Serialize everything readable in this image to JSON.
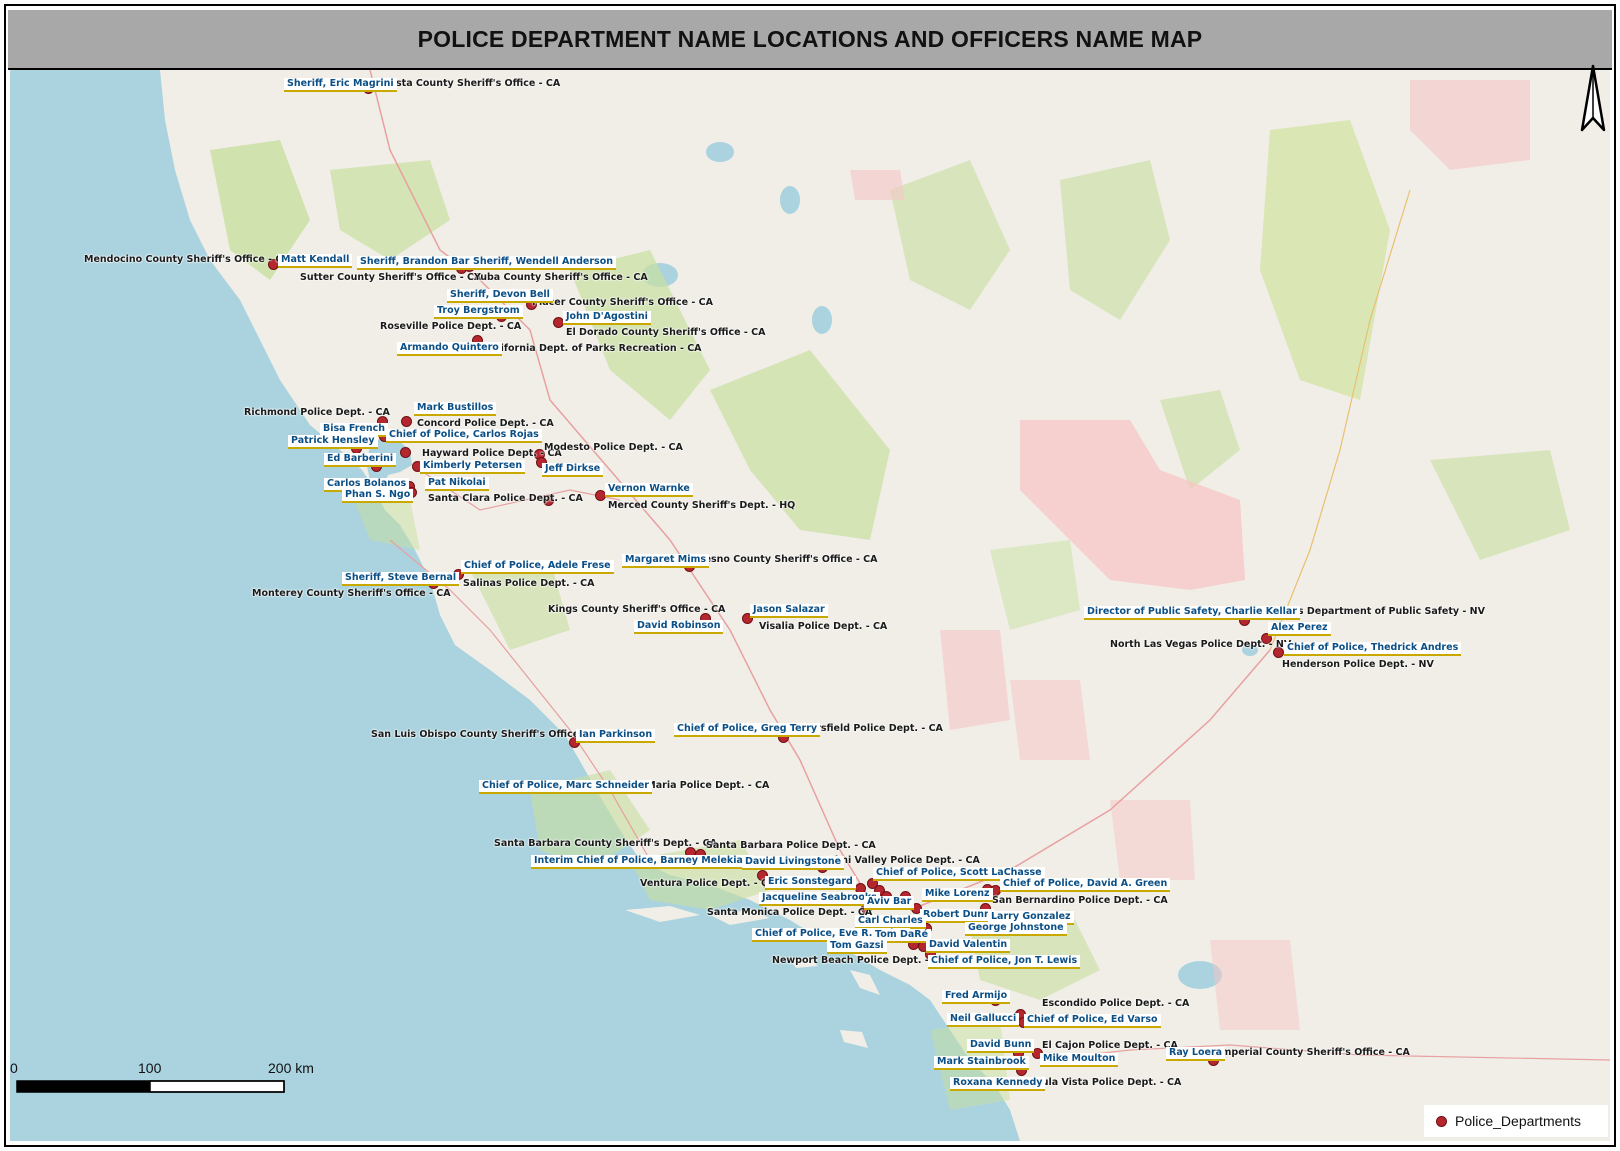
{
  "title": "POLICE DEPARTMENT NAME LOCATIONS AND OFFICERS NAME MAP",
  "colors": {
    "water": "#aad3df",
    "land": "#f1eee8",
    "park": "#c8df9f",
    "restricted": "#f5c6c6",
    "marker": "#b5272f",
    "officer_text": "#0b4f86",
    "officer_underline": "#c9a800"
  },
  "departments": [
    "Shasta County Sheriff's Office - CA",
    "Mendocino County Sheriff's Office - CA",
    "Sutter County Sheriff's Office - CA",
    "Yuba County Sheriff's Office - CA",
    "Placer County Sheriff's Office - CA",
    "El Dorado County Sheriff's Office - CA",
    "Roseville Police Dept. - CA",
    "California Dept. of Parks Recreation - CA",
    "Richmond Police Dept. - CA",
    "Concord Police Dept. - CA",
    "Hayward Police Dept. - CA",
    "Modesto Police Dept. - CA",
    "Santa Clara Police Dept. - CA",
    "Merced County Sheriff's Dept. - HQ",
    "Fresno County Sheriff's Office - CA",
    "Salinas Police Dept. - CA",
    "Monterey County Sheriff's Office - CA",
    "Kings County Sheriff's Office - CA",
    "Visalia Police Dept. - CA",
    "Las Vegas Department of Public Safety - NV",
    "North Las Vegas Police Dept. - NV",
    "Henderson Police Dept. - NV",
    "San Luis Obispo County Sheriff's Office - CA",
    "Bakersfield Police Dept. - CA",
    "Santa Maria Police Dept. - CA",
    "Santa Barbara County Sheriff's Dept. - CA",
    "Santa Barbara Police Dept. - CA",
    "Simi Valley Police Dept. - CA",
    "Ventura Police Dept. - CA",
    "San Bernardino Police Dept. - CA",
    "Santa Monica Police Dept. - CA",
    "Newport Beach Police Dept. - CA",
    "Escondido Police Dept. - CA",
    "El Cajon Police Dept. - CA",
    "Imperial County Sheriff's Office - CA",
    "Chula Vista Police Dept. - CA"
  ],
  "officers": [
    "Sheriff, Eric Magrini",
    "Matt Kendall",
    "Sheriff, Brandon Barnes",
    "Sheriff, Wendell Anderson",
    "Sheriff, Devon Bell",
    "Troy Bergstrom",
    "John D'Agostini",
    "Armando Quintero",
    "Mark Bustillos",
    "Bisa French",
    "Chief of Police, Carlos Rojas",
    "Patrick Hensley",
    "Jeff Dirkse",
    "Ed Barberini",
    "Kimberly Petersen",
    "Carlos Bolanos",
    "Pat Nikolai",
    "Phan S. Ngo",
    "Vernon Warnke",
    "Margaret Mims",
    "Chief of Police, Adele Frese",
    "Sheriff, Steve Bernal",
    "Jason Salazar",
    "David Robinson",
    "Director of Public Safety, Charlie Kellar",
    "Alex Perez",
    "Chief of Police, Thedrick Andres",
    "Ian Parkinson",
    "Chief of Police, Greg Terry",
    "Chief of Police, Marc Schneider",
    "Interim Chief of Police, Barney Melekian",
    "David Livingstone",
    "Eric Sonstegard",
    "Chief of Police, Scott LaChasse",
    "Chief of Police, David A. Green",
    "Jacqueline Seabrooks",
    "Mike Lorenz",
    "Aviv Bar",
    "Robert Dunn",
    "Larry Gonzalez",
    "Carl Charles",
    "George Johnstone",
    "Chief of Police, Eve R. Irvine",
    "Tom DaRé",
    "Tom Gazsi",
    "David Valentin",
    "Chief of Police, Jon T. Lewis",
    "Fred Armijo",
    "Neil Gallucci",
    "Chief of Police, Ed Varso",
    "David Bunn",
    "Mike Moulton",
    "Mark Stainbrook",
    "Ray Loera",
    "Roxana Kennedy"
  ],
  "scale_bar": {
    "ticks": [
      "0",
      "100",
      "200 km"
    ]
  },
  "legend": {
    "label": "Police_Departments"
  },
  "north_arrow": {
    "icon": "north-arrow-icon"
  }
}
